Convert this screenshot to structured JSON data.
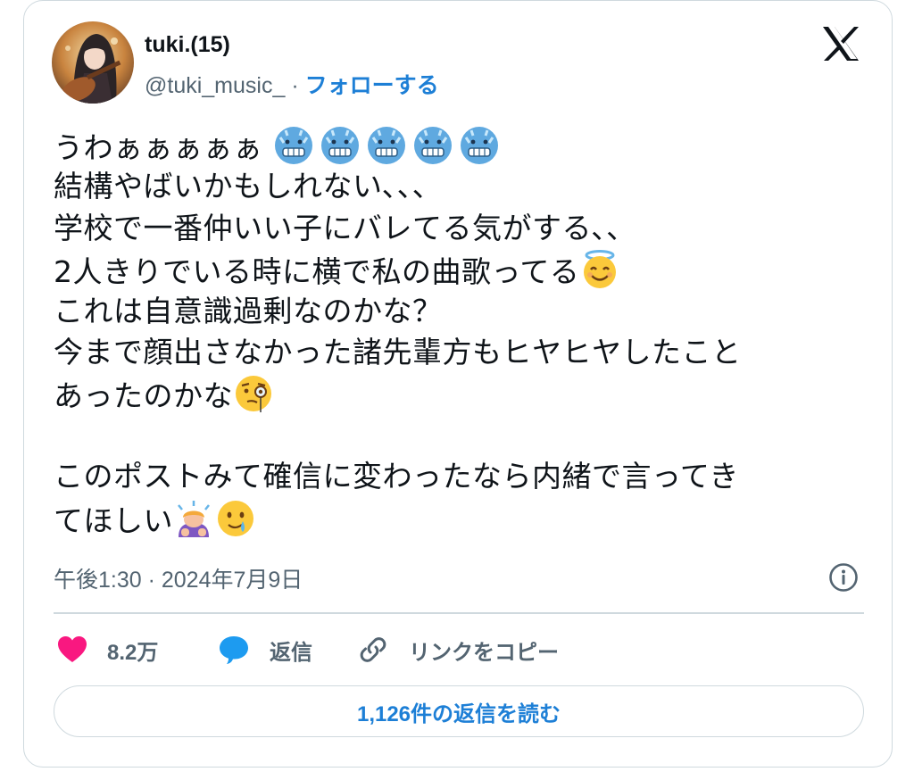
{
  "author": {
    "name": "tuki.(15)",
    "handle": "@tuki_music_",
    "separator": " · ",
    "follow_label": "フォローする"
  },
  "platform_icon": "x-logo-icon",
  "tweet": {
    "lines": [
      "うわぁぁぁぁぁ",
      "結構やばいかもしれない､､､",
      "学校で一番仲いい子にバレてる気がする､､",
      "2人きりでいる時に横で私の曲歌ってる",
      "これは自意識過剰なのかな？",
      "今まで顔出さなかった諸先輩方もヒヤヒヤしたこと",
      "あったのかな",
      "",
      "このポストみて確信に変わったなら内緒で言ってき",
      "てほしい"
    ],
    "emoji": {
      "line1": [
        "cold-face",
        "cold-face",
        "cold-face",
        "cold-face",
        "cold-face"
      ],
      "line4": [
        "smiling-face-with-halo"
      ],
      "line7": [
        "face-with-monocle"
      ],
      "line10": [
        "person-bowing",
        "smiling-face-with-tear"
      ]
    }
  },
  "timestamp": "午後1:30 · 2024年7月9日",
  "actions": {
    "like_count": "8.2万",
    "reply_label": "返信",
    "copy_link_label": "リンクをコピー"
  },
  "read_replies_label": "1,126件の返信を読む",
  "colors": {
    "link_blue": "#1d7fd6",
    "like_pink": "#f91880",
    "reply_blue": "#1d9bf0",
    "muted_gray": "#536471",
    "border": "#cfd9de"
  }
}
